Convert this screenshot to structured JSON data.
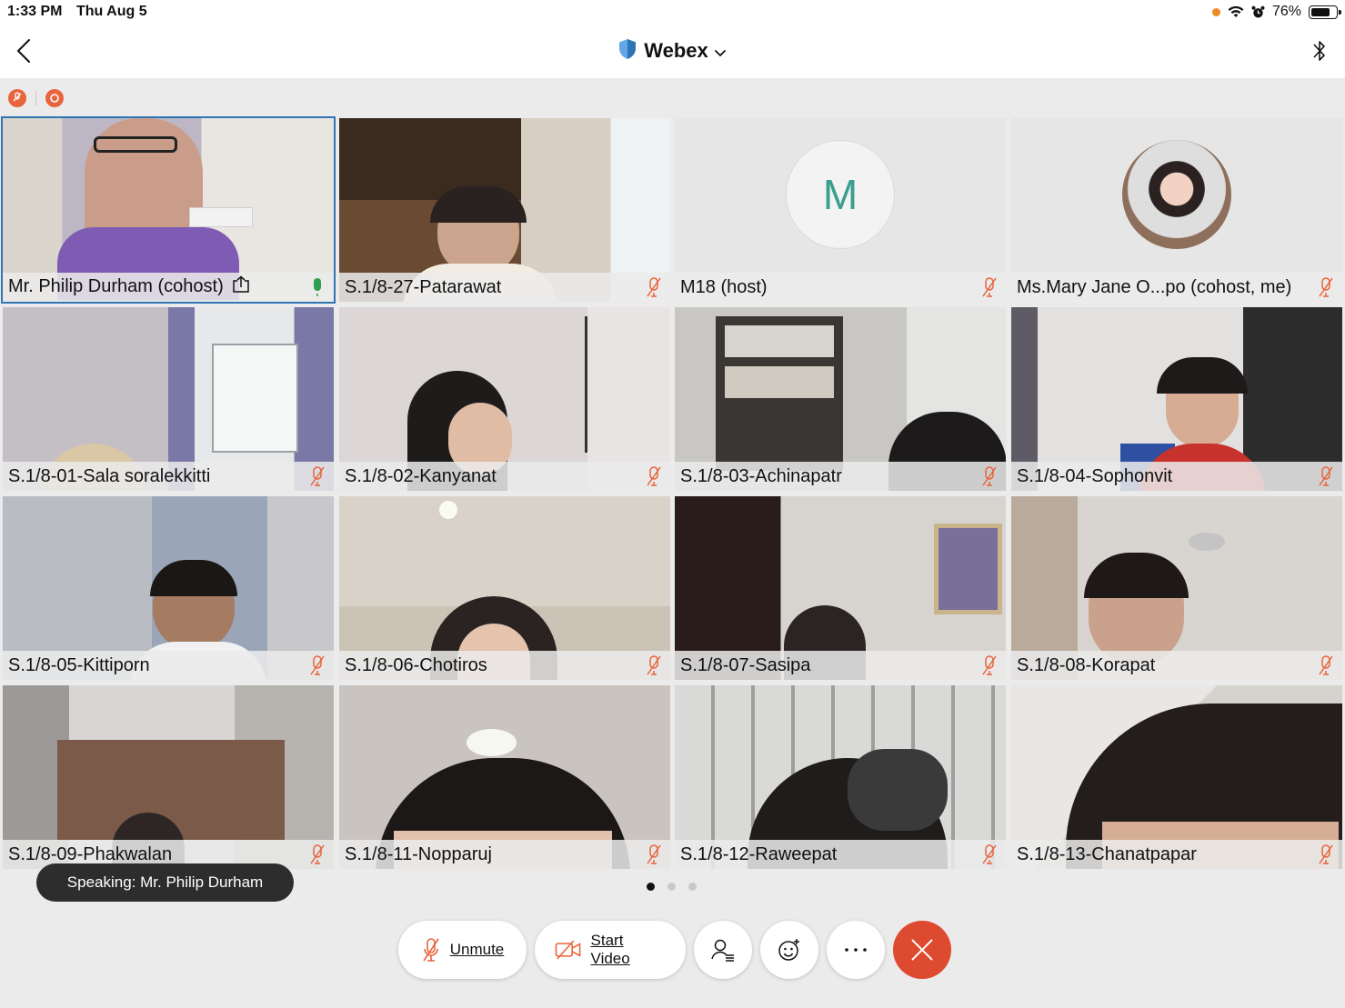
{
  "status_bar": {
    "time": "1:33 PM",
    "date": "Thu Aug 5",
    "battery": "76%",
    "battery_level": 0.76
  },
  "header": {
    "title": "Webex"
  },
  "tiles": [
    {
      "name": "Mr. Philip Durham (cohost)",
      "mic": "on",
      "sharing": true,
      "active": true
    },
    {
      "name": "S.1/8-27-Patarawat",
      "mic": "muted"
    },
    {
      "name": "M18 (host)",
      "mic": "muted",
      "avatar_letter": "M"
    },
    {
      "name": "Ms.Mary Jane O...po (cohost, me)",
      "mic": "muted"
    },
    {
      "name": "S.1/8-01-Sala soralekkitti",
      "mic": "muted"
    },
    {
      "name": "S.1/8-02-Kanyanat",
      "mic": "muted"
    },
    {
      "name": "S.1/8-03-Achinapatr",
      "mic": "muted"
    },
    {
      "name": "S.1/8-04-Sophonvit",
      "mic": "muted"
    },
    {
      "name": "S.1/8-05-Kittiporn",
      "mic": "muted"
    },
    {
      "name": "S.1/8-06-Chotiros",
      "mic": "muted"
    },
    {
      "name": "S.1/8-07-Sasipa",
      "mic": "muted"
    },
    {
      "name": "S.1/8-08-Korapat",
      "mic": "muted"
    },
    {
      "name": "S.1/8-09-Phakwalan",
      "mic": "muted"
    },
    {
      "name": "S.1/8-11-Nopparuj",
      "mic": "muted"
    },
    {
      "name": "S.1/8-12-Raweepat",
      "mic": "muted"
    },
    {
      "name": "S.1/8-13-Chanatpapar",
      "mic": "muted"
    }
  ],
  "toast": {
    "text": "Speaking: Mr. Philip Durham"
  },
  "pagination": {
    "pages": 3,
    "current": 1
  },
  "controls": {
    "unmute_label": "Unmute",
    "start_video_label": "Start Video"
  },
  "colors": {
    "accent": "#2f74b5",
    "end_call": "#de4a2f",
    "muted_icon": "#e8643c",
    "mic_on": "#2e9e4f",
    "avatar_letter": "#3a9e8f"
  },
  "icons": [
    "back-chevron",
    "shield",
    "chevron-down",
    "bluetooth",
    "wifi",
    "alarm",
    "battery",
    "mic-muted",
    "mic-on",
    "share",
    "video-off",
    "participants",
    "reactions",
    "more",
    "close"
  ]
}
